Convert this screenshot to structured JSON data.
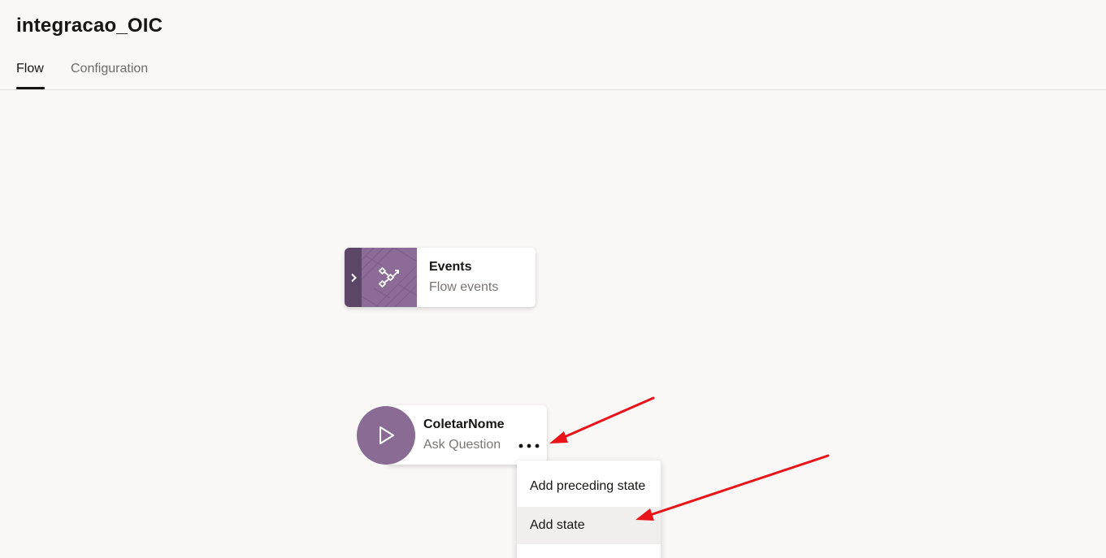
{
  "header": {
    "title": "integracao_OIC"
  },
  "tabs": [
    {
      "label": "Flow",
      "active": true
    },
    {
      "label": "Configuration",
      "active": false
    }
  ],
  "events_node": {
    "title": "Events",
    "subtitle": "Flow events",
    "toggle_icon": "chevron-right-icon",
    "icon": "flow-events-icon"
  },
  "state_node": {
    "title": "ColetarNome",
    "subtitle": "Ask Question",
    "icon": "play-icon",
    "more_icon": "more-horizontal-icon"
  },
  "context_menu": {
    "items": [
      {
        "label": "Add preceding state"
      },
      {
        "label": "Add state",
        "hovered": true
      }
    ]
  },
  "colors": {
    "accent_purple": "#8a6b94",
    "dark_purple": "#5c4668",
    "annotation_arrow": "#e8141a"
  }
}
